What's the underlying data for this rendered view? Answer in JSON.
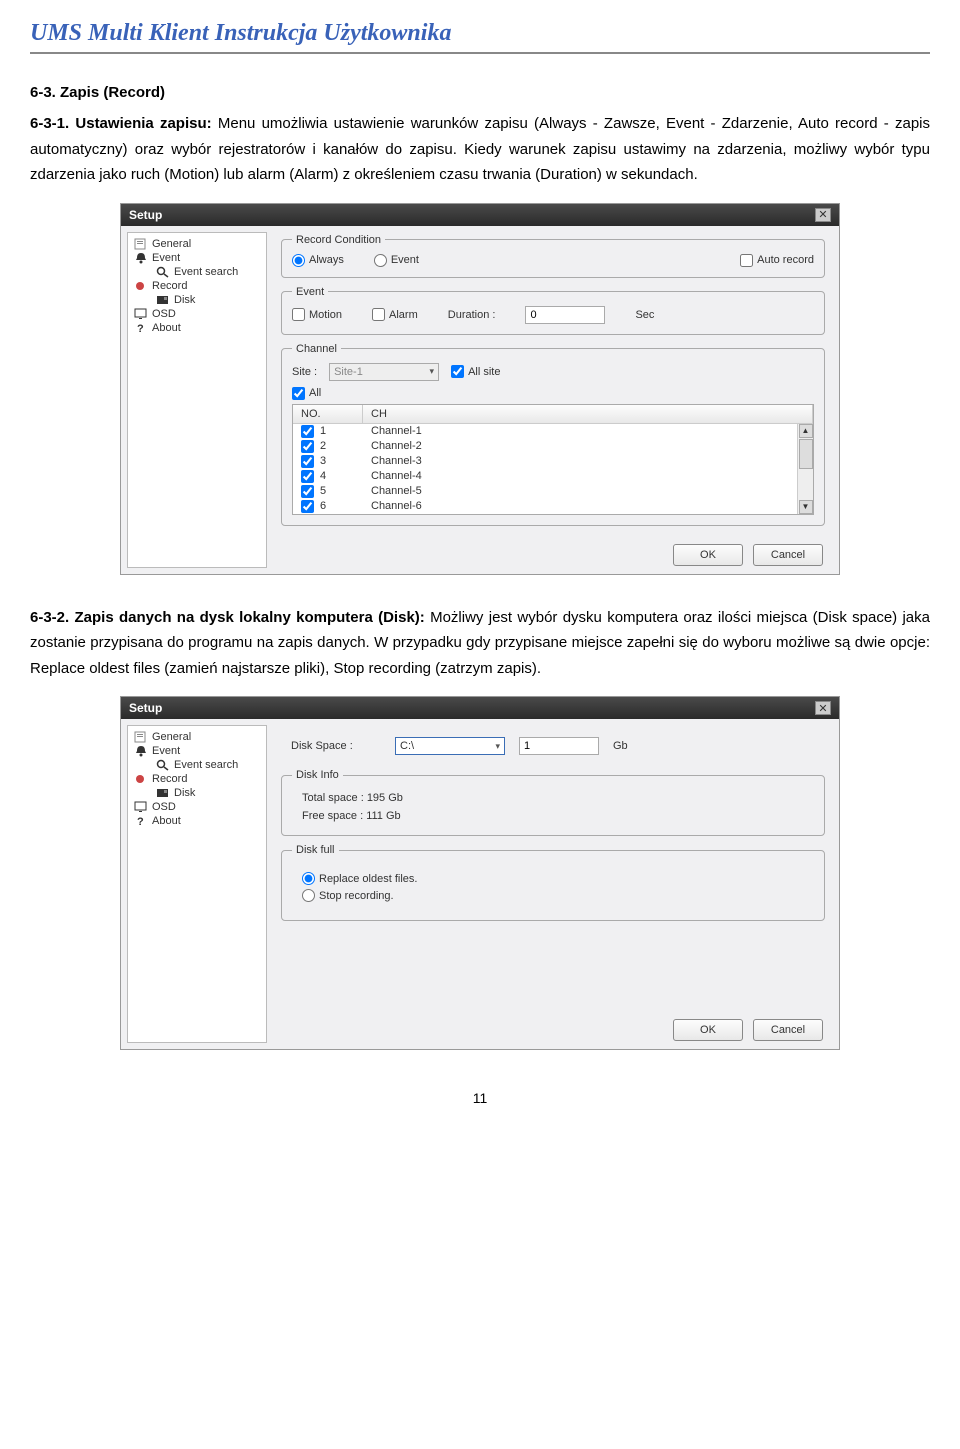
{
  "page_title": "UMS Multi Klient Instrukcja Użytkownika",
  "h_63": "6-3. Zapis (Record)",
  "p631_lead": "6-3-1. Ustawienia zapisu:",
  "p631_body": "Menu umożliwia ustawienie warunków zapisu (Always - Zawsze, Event - Zdarzenie, Auto record - zapis automatyczny) oraz wybór rejestratorów i kanałów do zapisu. Kiedy warunek zapisu ustawimy na zdarzenia, możliwy wybór typu zdarzenia jako ruch (Motion) lub alarm (Alarm) z określeniem czasu trwania (Duration) w sekundach.",
  "p632_lead": "6-3-2. Zapis danych na dysk lokalny komputera (Disk):",
  "p632_body": "Możliwy jest wybór dysku komputera oraz ilości miejsca (Disk space) jaka zostanie przypisana do programu na zapis danych. W przypadku gdy przypisane miejsce zapełni się do wyboru możliwe są dwie opcje: Replace oldest files (zamień najstarsze pliki), Stop recording (zatrzym zapis).",
  "win": {
    "title": "Setup",
    "sidebar": {
      "general": "General",
      "event": "Event",
      "event_search": "Event search",
      "record": "Record",
      "disk": "Disk",
      "osd": "OSD",
      "about": "About"
    },
    "ok": "OK",
    "cancel": "Cancel"
  },
  "rec": {
    "fs_cond": "Record Condition",
    "always": "Always",
    "event": "Event",
    "autorec": "Auto record",
    "fs_event": "Event",
    "motion": "Motion",
    "alarm": "Alarm",
    "duration": "Duration :",
    "dur_val": "0",
    "sec": "Sec",
    "fs_channel": "Channel",
    "site_lbl": "Site :",
    "site_sel": "Site-1",
    "allsite": "All site",
    "all": "All",
    "th_no": "NO.",
    "th_ch": "CH",
    "rows": [
      {
        "n": "1",
        "c": "Channel-1"
      },
      {
        "n": "2",
        "c": "Channel-2"
      },
      {
        "n": "3",
        "c": "Channel-3"
      },
      {
        "n": "4",
        "c": "Channel-4"
      },
      {
        "n": "5",
        "c": "Channel-5"
      },
      {
        "n": "6",
        "c": "Channel-6"
      }
    ]
  },
  "disk": {
    "space_lbl": "Disk Space :",
    "drive": "C:\\",
    "val": "1",
    "gb": "Gb",
    "fs_info": "Disk Info",
    "total": "Total space : 195 Gb",
    "free": "Free space : 111 Gb",
    "fs_full": "Disk full",
    "replace": "Replace oldest files.",
    "stop": "Stop recording."
  },
  "page_number": "11"
}
